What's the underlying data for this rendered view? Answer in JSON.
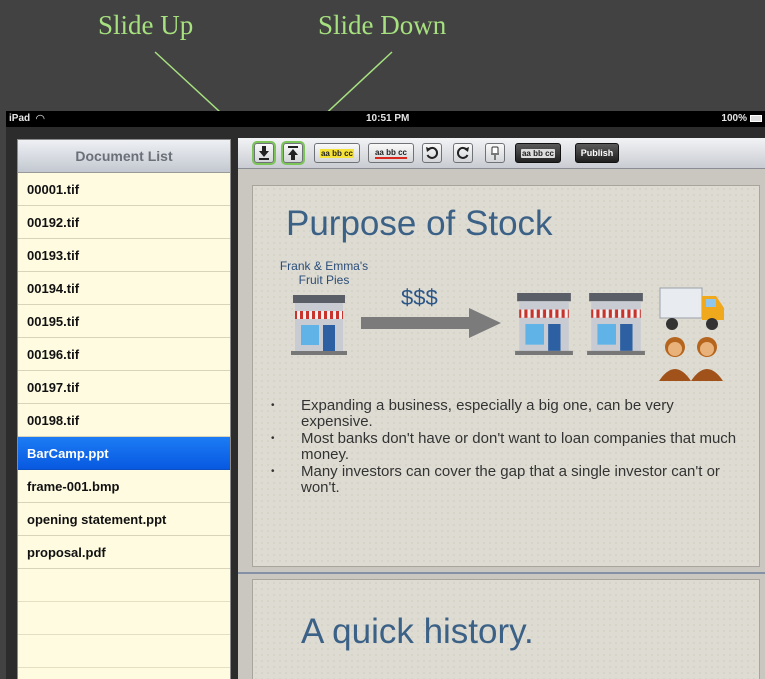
{
  "callouts": {
    "slide_up": "Slide Up",
    "slide_down": "Slide Down"
  },
  "status_bar": {
    "carrier": "iPad",
    "time": "10:51 PM",
    "battery": "100%"
  },
  "sidebar": {
    "title": "Document List",
    "items": [
      {
        "label": "00001.tif"
      },
      {
        "label": "00192.tif"
      },
      {
        "label": "00193.tif"
      },
      {
        "label": "00194.tif"
      },
      {
        "label": "00195.tif"
      },
      {
        "label": "00196.tif"
      },
      {
        "label": "00197.tif"
      },
      {
        "label": "00198.tif"
      },
      {
        "label": "BarCamp.ppt",
        "selected": true
      },
      {
        "label": "frame-001.bmp"
      },
      {
        "label": "opening statement.ppt"
      },
      {
        "label": "proposal.pdf"
      }
    ]
  },
  "toolbar": {
    "highlight_sample": "aa bb cc",
    "highlight_word": "bb",
    "underline_sample": "aa bb cc",
    "underline_word": "bb",
    "strike_sample": "aa bb cc",
    "publish_label": "Publish"
  },
  "slides": [
    {
      "title": "Purpose of Stock",
      "company": "Frank & Emma's Fruit Pies",
      "money": "$$$",
      "bullets": [
        "Expanding a business, especially a big one, can be very expensive.",
        "Most banks don't have or don't want to loan companies that much money.",
        "Many investors can cover the gap that a single investor can't or won't."
      ]
    },
    {
      "title": "A quick history."
    }
  ],
  "colors": {
    "callout": "#a6e07f",
    "selection": "#0a63e8",
    "slide_title": "#3c6187"
  }
}
